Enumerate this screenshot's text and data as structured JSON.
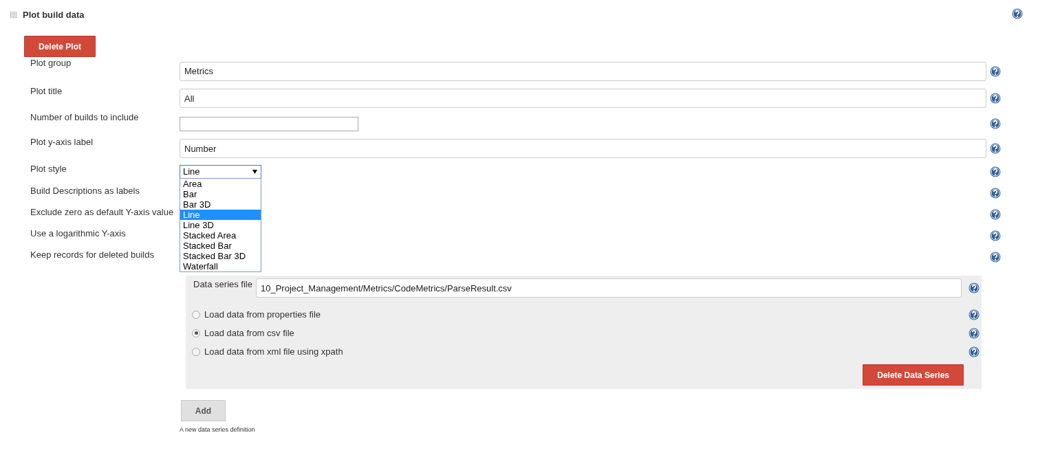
{
  "section": {
    "title": "Plot build data"
  },
  "delete_plot_button": "Delete Plot",
  "fields": [
    {
      "kind": "text",
      "label": "Plot group",
      "value": "Metrics"
    },
    {
      "kind": "text",
      "label": "Plot title",
      "value": "All"
    },
    {
      "kind": "short",
      "label": "Number of builds to include"
    },
    {
      "kind": "text",
      "label": "Plot y-axis label",
      "value": "Number"
    },
    {
      "kind": "select",
      "label": "Plot style",
      "value": "Line",
      "expanded": true,
      "options": [
        {
          "label": "Area",
          "selected": false
        },
        {
          "label": "Bar",
          "selected": false
        },
        {
          "label": "Bar 3D",
          "selected": false
        },
        {
          "label": "Line",
          "selected": true
        },
        {
          "label": "Line 3D",
          "selected": false
        },
        {
          "label": "Stacked Area",
          "selected": false
        },
        {
          "label": "Stacked Bar",
          "selected": false
        },
        {
          "label": "Stacked Bar 3D",
          "selected": false
        },
        {
          "label": "Waterfall",
          "selected": false
        }
      ]
    },
    {
      "kind": "plain",
      "label": "Build Descriptions as labels"
    },
    {
      "kind": "plain",
      "label": "Exclude zero as default Y-axis value"
    },
    {
      "kind": "plain",
      "label": "Use a logarithmic Y-axis"
    },
    {
      "kind": "plain",
      "label": "Keep records for deleted builds"
    }
  ],
  "data_series": {
    "file_label": "Data series file",
    "file_value": "10_Project_Management/Metrics/CodeMetrics/ParseResult.csv",
    "sources": [
      {
        "label": "Load data from properties file",
        "selected": false
      },
      {
        "label": "Load data from csv file",
        "selected": true
      },
      {
        "label": "Load data from xml file using xpath",
        "selected": false
      }
    ],
    "delete_button": "Delete Data Series"
  },
  "add_button": "Add",
  "add_note": "A new data series definition"
}
